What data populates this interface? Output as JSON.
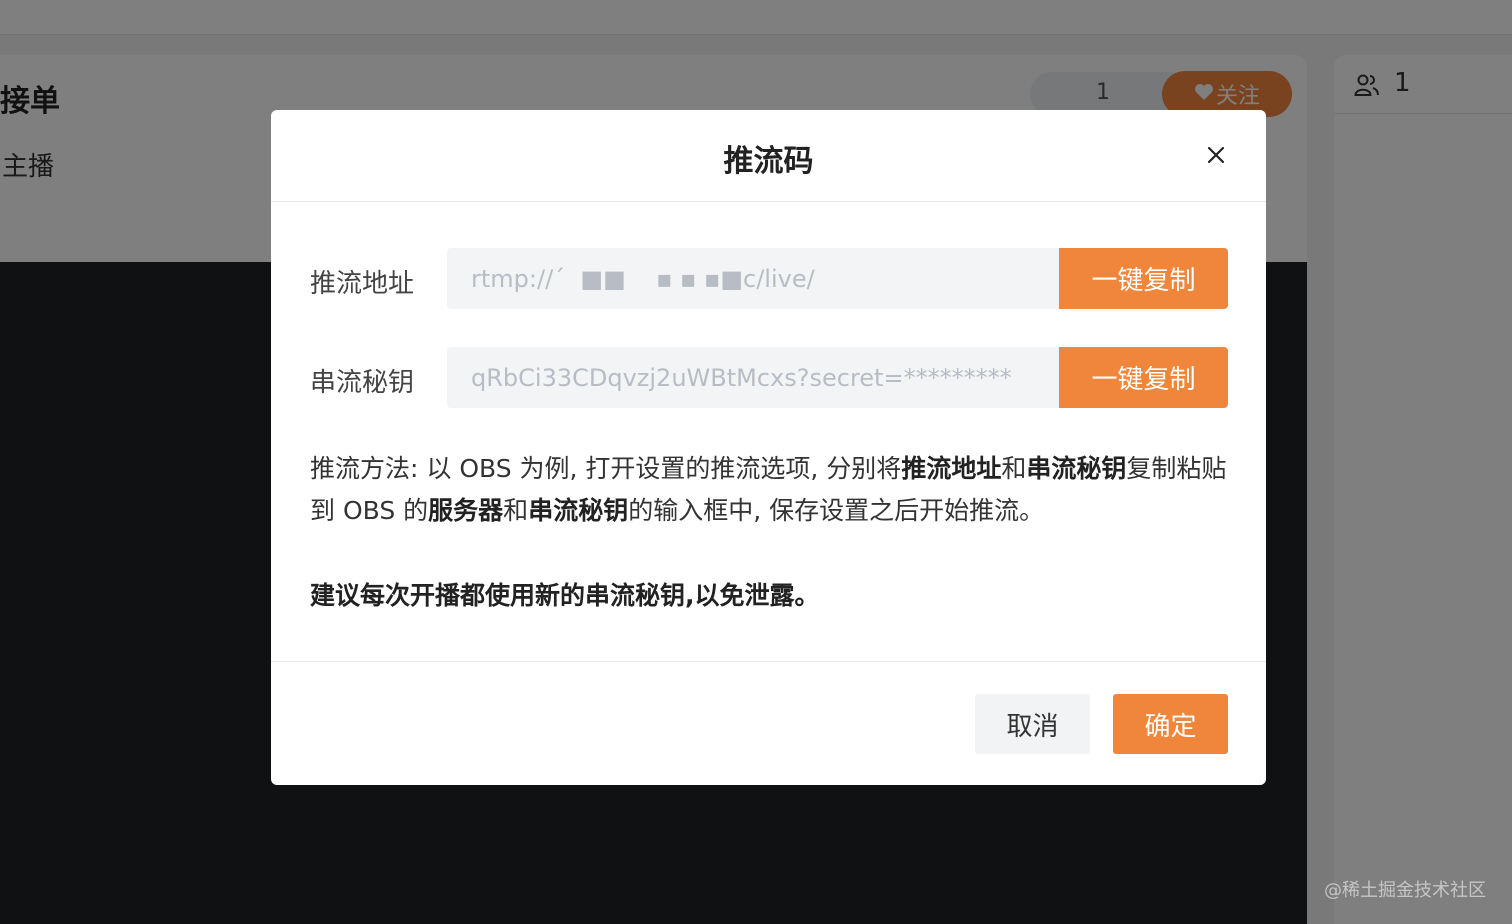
{
  "background": {
    "title": "接单",
    "subtitle": "主播",
    "count": "1",
    "follow_label": "关注",
    "viewer_count": "1",
    "watermark": "@稀土掘金技术社区"
  },
  "modal": {
    "title": "推流码",
    "fields": [
      {
        "label": "推流地址",
        "value": "rtmp://´  ■■    ▪ ▪ ▪■c/live/",
        "button": "一键复制"
      },
      {
        "label": "串流秘钥",
        "value": "qRbCi33CDqvzj2uWBtMcxs?secret=*********",
        "button": "一键复制"
      }
    ],
    "description": {
      "p1": "推流方法: 以 OBS 为例, 打开设置的推流选项, 分别将",
      "b1": "推流地址",
      "p2": "和",
      "b2": "串流秘钥",
      "p3": "复制粘贴到 OBS 的",
      "b3": "服务器",
      "p4": "和",
      "b4": "串流秘钥",
      "p5": "的输入框中, 保存设置之后开始推流。"
    },
    "warning": "建议每次开播都使用新的串流秘钥,以免泄露。",
    "cancel_label": "取消",
    "ok_label": "确定"
  },
  "colors": {
    "accent": "#f0863c",
    "input_bg": "#f3f4f6",
    "overlay": "rgba(0,0,0,0.5)"
  }
}
